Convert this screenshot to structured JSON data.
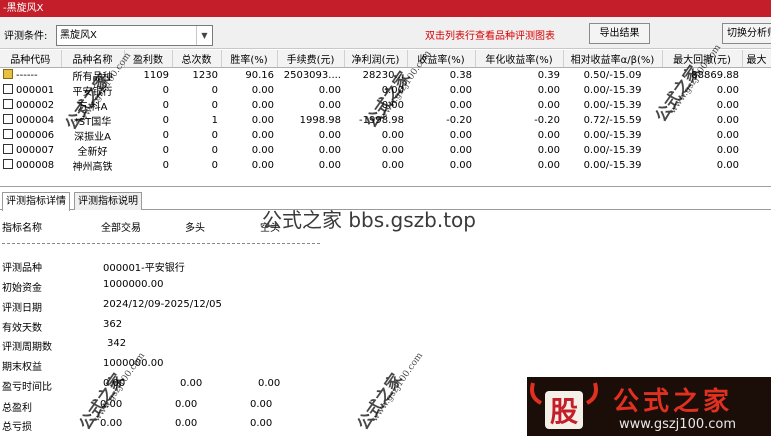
{
  "window": {
    "title": "-黑旋风X"
  },
  "toolbar": {
    "criteria_label": "评测条件:",
    "criteria_value": "黑旋风X",
    "hint": "双击列表行查看品种评测图表",
    "export_label": "导出结果",
    "switch_label": "切换分析师"
  },
  "grid": {
    "columns": [
      "品种代码",
      "品种名称",
      "盈利数",
      "总次数",
      "胜率(%)",
      "手续费(元)",
      "净利润(元)",
      "收益率(%)",
      "年化收益率(%)",
      "相对收益率α/β(%)",
      "最大回撤(元)",
      "最大"
    ],
    "rows": [
      {
        "code": "------",
        "name": "所有品种",
        "win": "1109",
        "total": "1230",
        "rate": "90.16",
        "fee": "2503093....",
        "profit": "28230...",
        "ret": "0.38",
        "annual": "0.39",
        "rel": "0.50/-15.09",
        "dd": "88869.88",
        "max": ""
      },
      {
        "code": "000001",
        "name": "平安银行",
        "win": "0",
        "total": "0",
        "rate": "0.00",
        "fee": "0.00",
        "profit": "0.00",
        "ret": "0.00",
        "annual": "0.00",
        "rel": "0.00/-15.39",
        "dd": "0.00",
        "max": ""
      },
      {
        "code": "000002",
        "name": "万 科A",
        "win": "0",
        "total": "0",
        "rate": "0.00",
        "fee": "0.00",
        "profit": "0.00",
        "ret": "0.00",
        "annual": "0.00",
        "rel": "0.00/-15.39",
        "dd": "0.00",
        "max": ""
      },
      {
        "code": "000004",
        "name": "*ST国华",
        "win": "0",
        "total": "1",
        "rate": "0.00",
        "fee": "1998.98",
        "profit": "-1998.98",
        "ret": "-0.20",
        "annual": "-0.20",
        "rel": "0.72/-15.59",
        "dd": "0.00",
        "max": ""
      },
      {
        "code": "000006",
        "name": "深振业A",
        "win": "0",
        "total": "0",
        "rate": "0.00",
        "fee": "0.00",
        "profit": "0.00",
        "ret": "0.00",
        "annual": "0.00",
        "rel": "0.00/-15.39",
        "dd": "0.00",
        "max": ""
      },
      {
        "code": "000007",
        "name": "全新好",
        "win": "0",
        "total": "0",
        "rate": "0.00",
        "fee": "0.00",
        "profit": "0.00",
        "ret": "0.00",
        "annual": "0.00",
        "rel": "0.00/-15.39",
        "dd": "0.00",
        "max": ""
      },
      {
        "code": "000008",
        "name": "神州高铁",
        "win": "0",
        "total": "0",
        "rate": "0.00",
        "fee": "0.00",
        "profit": "0.00",
        "ret": "0.00",
        "annual": "0.00",
        "rel": "0.00/-15.39",
        "dd": "0.00",
        "max": ""
      }
    ]
  },
  "tabs": {
    "detail": "评测指标详情",
    "explain": "评测指标说明"
  },
  "detail": {
    "header": {
      "name": "指标名称",
      "all": "全部交易",
      "long": "多头",
      "short": "空头"
    },
    "fields": {
      "symbol_label": "评测品种",
      "symbol_value": "000001-平安银行",
      "capital_label": "初始资金",
      "capital_value": "1000000.00",
      "date_label": "评测日期",
      "date_value": "2024/12/09-2025/12/05",
      "days_label": "有效天数",
      "days_value": "362",
      "periods_label": "评测周期数",
      "periods_value": "342",
      "equity_label": "期末权益",
      "equity_value": "1000000.00"
    },
    "rows": [
      {
        "label": "盈亏时间比",
        "all": "0.00",
        "long": "0.00",
        "short": "0.00"
      },
      {
        "label": "总盈利",
        "all": "0.00",
        "long": "0.00",
        "short": "0.00"
      },
      {
        "label": "总亏损",
        "all": "0.00",
        "long": "0.00",
        "short": "0.00"
      }
    ]
  },
  "watermarks": {
    "site": "公式之家 bbs.gszb.top",
    "stamp": "公式之家",
    "stamp_url": "www.gszj100.com",
    "logo_glyph": "股",
    "logo_text": "公式之家",
    "logo_url": "www.gszj100.com"
  },
  "colors": {
    "title_bar": "#c41e2a",
    "hint": "#d80000",
    "logo_bg": "#1b0d08",
    "logo_red": "#e03020"
  }
}
